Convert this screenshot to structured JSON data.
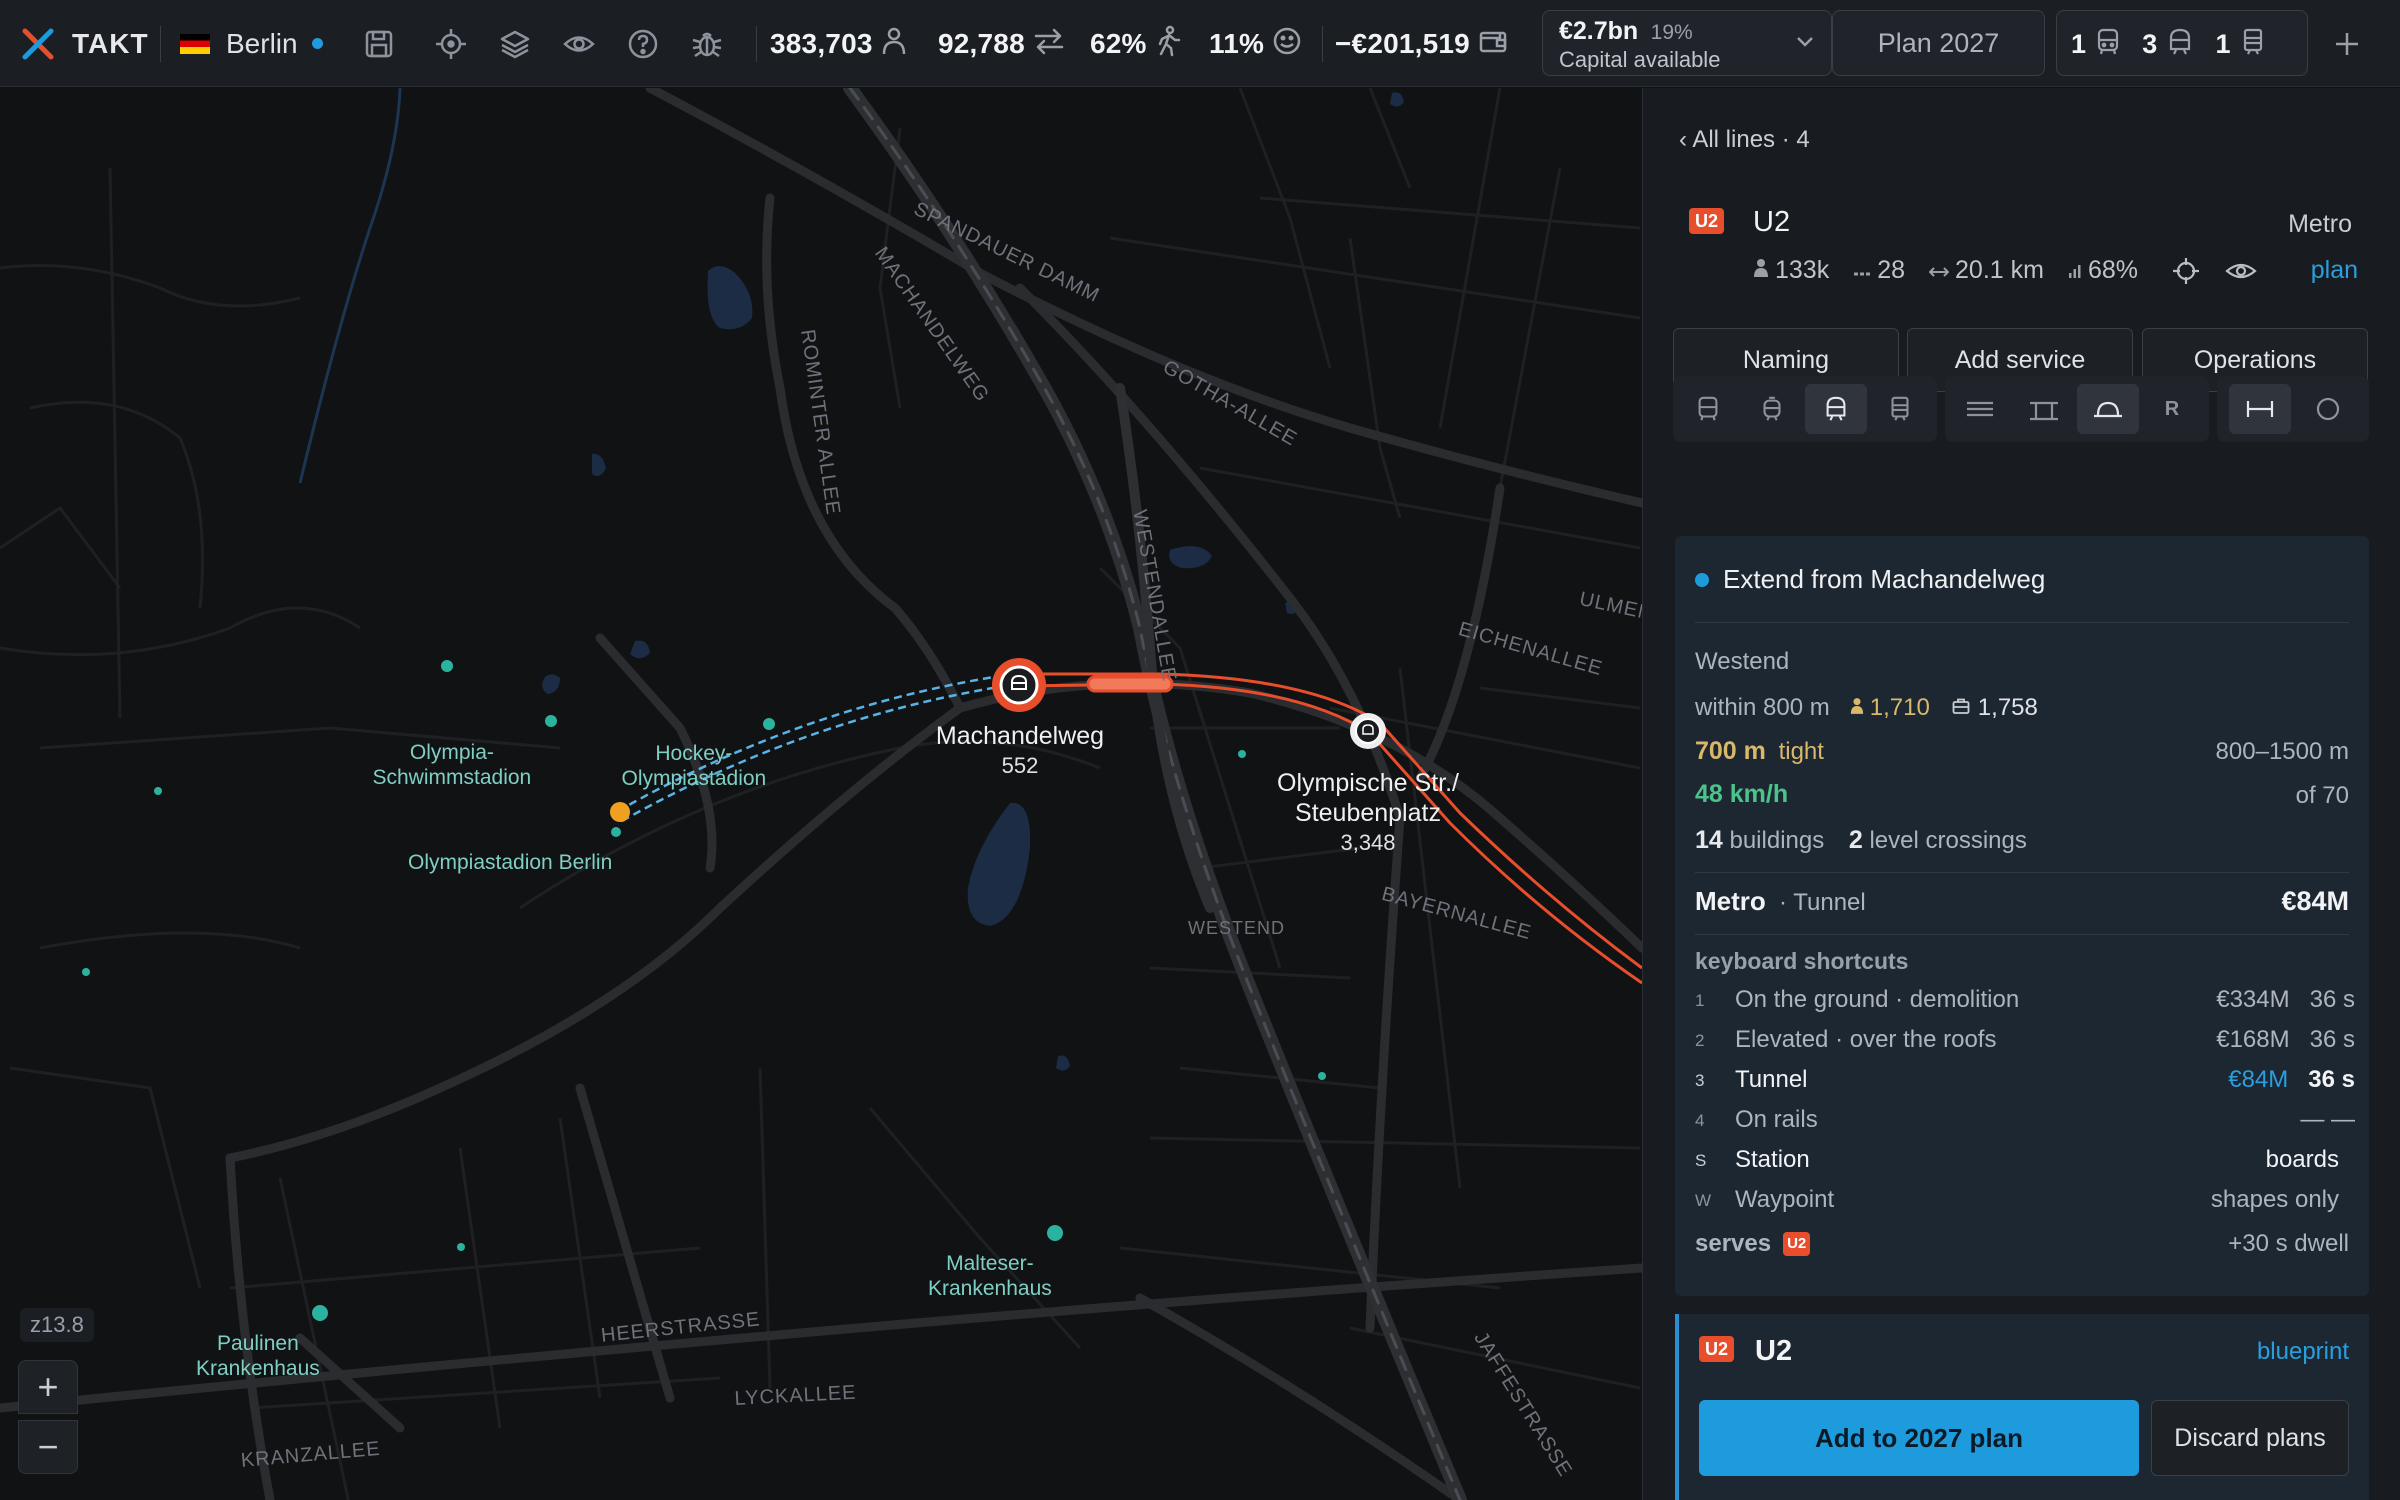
{
  "app": {
    "name": "TAKT",
    "city": "Berlin"
  },
  "stats": {
    "population": "383,703",
    "trips": "92,788",
    "walk_share": "62%",
    "satisfaction": "11%",
    "balance": "−€201,519"
  },
  "capital": {
    "amount": "€2.7bn",
    "percent": "19%",
    "label": "Capital available"
  },
  "plan_button": "Plan 2027",
  "fleet": [
    {
      "count": "1",
      "icon": "bus-icon"
    },
    {
      "count": "3",
      "icon": "metro-icon"
    },
    {
      "count": "1",
      "icon": "train-icon"
    }
  ],
  "map": {
    "zoom_label": "z13.8",
    "streets": [
      "SPANDAUER DAMM",
      "MACHANDELWEG",
      "ROMINTER ALLEE",
      "GOTHA-ALLEE",
      "WESTENDALLEE",
      "ULMEN",
      "EICHENALLEE",
      "BAYERNALLEE",
      "WESTEND",
      "HEERSTRASSE",
      "LYCKALLEE",
      "KRANZALLEE",
      "JAFFESTRASSE"
    ],
    "pois": [
      "Olympia-\nSchwimmstadion",
      "Hockey-\nOlympiastadion",
      "Olympiastadion Berlin",
      "Malteser-\nKrankenhaus",
      "Paulinen\nKrankenhaus"
    ],
    "stations": [
      {
        "name": "Machandelweg",
        "count": "552"
      },
      {
        "name": "Olympische Str./\nSteubenplatz",
        "count": "3,348"
      }
    ],
    "line_color": "#e84e2c",
    "proposed_color": "#58b4e8"
  },
  "panel": {
    "back_link": "‹ All lines · 4",
    "line": {
      "badge": "U2",
      "name": "U2",
      "type": "Metro",
      "riders": "133k",
      "stations": "28",
      "length": "20.1 km",
      "load": "68%",
      "plan_link": "plan"
    },
    "tabs": [
      "Naming",
      "Add service",
      "Operations"
    ],
    "r_label": "R",
    "extend": {
      "title": "Extend from Machandelweg",
      "area": "Westend",
      "within": "within 800 m",
      "people": "1,710",
      "jobs": "1,758",
      "spacing": "700 m",
      "spacing_note": "tight",
      "spacing_range": "800–1500 m",
      "speed": "48 km/h",
      "speed_of": "of 70",
      "buildings": "14",
      "buildings_label": "buildings",
      "crossings": "2",
      "crossings_label": "level crossings",
      "mode": "Metro",
      "mode_detail": "· Tunnel",
      "cost": "€84M",
      "shortcuts_title": "keyboard shortcuts",
      "shortcuts": [
        {
          "key": "1",
          "label": "On the ground · demolition",
          "cost": "€334M",
          "time": "36 s"
        },
        {
          "key": "2",
          "label": "Elevated · over the roofs",
          "cost": "€168M",
          "time": "36 s"
        },
        {
          "key": "3",
          "label": "Tunnel",
          "cost": "€84M",
          "time": "36 s"
        },
        {
          "key": "4",
          "label": "On rails",
          "value": "— —"
        },
        {
          "key": "S",
          "label": "Station",
          "value": "boards"
        },
        {
          "key": "W",
          "label": "Waypoint",
          "value": "shapes only"
        }
      ],
      "serves_label": "serves",
      "serves_badge": "U2",
      "dwell": "+30 s dwell"
    },
    "bottom": {
      "badge": "U2",
      "name": "U2",
      "blueprint": "blueprint",
      "add_button": "Add to 2027 plan",
      "discard_button": "Discard plans"
    }
  },
  "colors": {
    "accent": "#1e9bdc",
    "line": "#e84e2c",
    "good": "#4cc38a",
    "warn": "#d9b86a",
    "teal": "#2bb3a0"
  }
}
